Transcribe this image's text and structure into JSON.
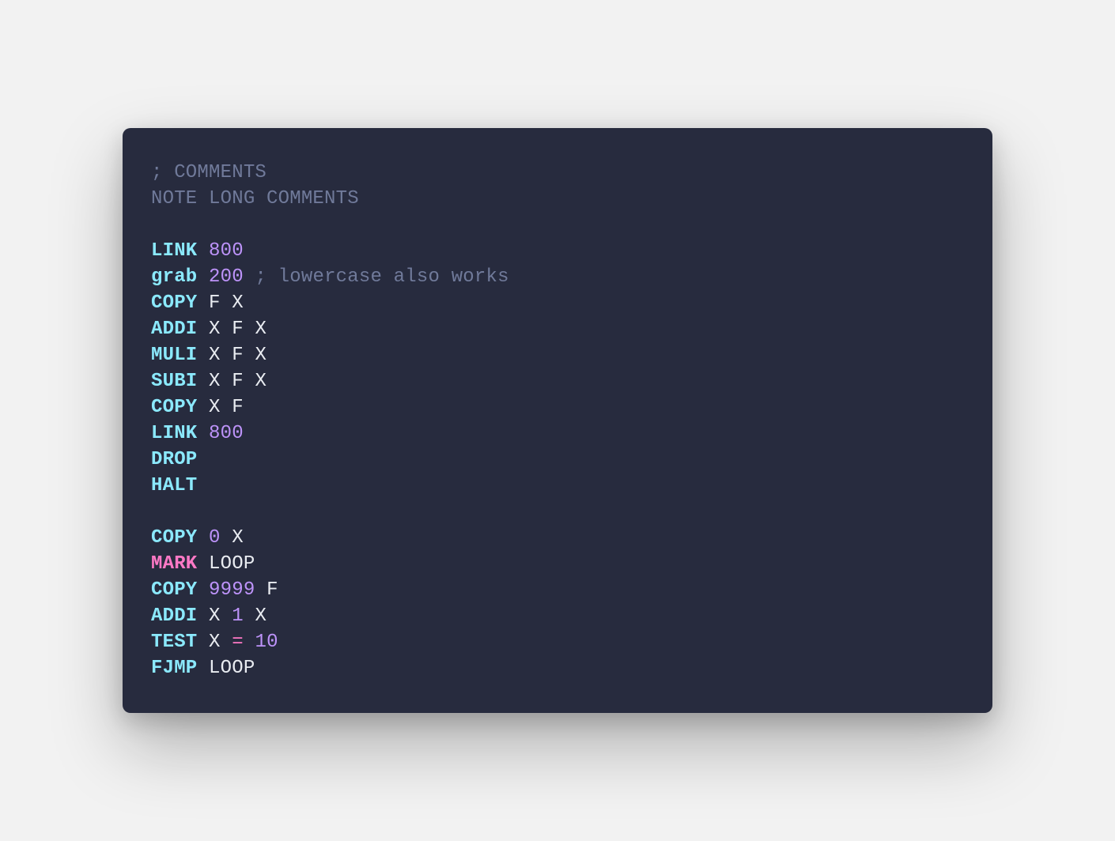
{
  "colors": {
    "page_bg": "#f2f2f2",
    "card_bg": "#272b3e",
    "comment": "#707a9a",
    "keyword": "#8be9fd",
    "mark": "#ff79c6",
    "number": "#bd93f9",
    "operator": "#ff79c6",
    "text": "#e9ecf1"
  },
  "code_lines": [
    [
      {
        "type": "comment",
        "text": "; COMMENTS"
      }
    ],
    [
      {
        "type": "comment",
        "text": "NOTE LONG COMMENTS"
      }
    ],
    [],
    [
      {
        "type": "keyword",
        "text": "LINK"
      },
      {
        "type": "space",
        "text": " "
      },
      {
        "type": "number",
        "text": "800"
      }
    ],
    [
      {
        "type": "keyword",
        "text": "grab"
      },
      {
        "type": "space",
        "text": " "
      },
      {
        "type": "number",
        "text": "200"
      },
      {
        "type": "space",
        "text": " "
      },
      {
        "type": "comment",
        "text": "; lowercase also works"
      }
    ],
    [
      {
        "type": "keyword",
        "text": "COPY"
      },
      {
        "type": "space",
        "text": " "
      },
      {
        "type": "text",
        "text": "F X"
      }
    ],
    [
      {
        "type": "keyword",
        "text": "ADDI"
      },
      {
        "type": "space",
        "text": " "
      },
      {
        "type": "text",
        "text": "X F X"
      }
    ],
    [
      {
        "type": "keyword",
        "text": "MULI"
      },
      {
        "type": "space",
        "text": " "
      },
      {
        "type": "text",
        "text": "X F X"
      }
    ],
    [
      {
        "type": "keyword",
        "text": "SUBI"
      },
      {
        "type": "space",
        "text": " "
      },
      {
        "type": "text",
        "text": "X F X"
      }
    ],
    [
      {
        "type": "keyword",
        "text": "COPY"
      },
      {
        "type": "space",
        "text": " "
      },
      {
        "type": "text",
        "text": "X F"
      }
    ],
    [
      {
        "type": "keyword",
        "text": "LINK"
      },
      {
        "type": "space",
        "text": " "
      },
      {
        "type": "number",
        "text": "800"
      }
    ],
    [
      {
        "type": "keyword",
        "text": "DROP"
      }
    ],
    [
      {
        "type": "keyword",
        "text": "HALT"
      }
    ],
    [],
    [
      {
        "type": "keyword",
        "text": "COPY"
      },
      {
        "type": "space",
        "text": " "
      },
      {
        "type": "number",
        "text": "0"
      },
      {
        "type": "space",
        "text": " "
      },
      {
        "type": "text",
        "text": "X"
      }
    ],
    [
      {
        "type": "mark",
        "text": "MARK"
      },
      {
        "type": "space",
        "text": " "
      },
      {
        "type": "text",
        "text": "LOOP"
      }
    ],
    [
      {
        "type": "keyword",
        "text": "COPY"
      },
      {
        "type": "space",
        "text": " "
      },
      {
        "type": "number",
        "text": "9999"
      },
      {
        "type": "space",
        "text": " "
      },
      {
        "type": "text",
        "text": "F"
      }
    ],
    [
      {
        "type": "keyword",
        "text": "ADDI"
      },
      {
        "type": "space",
        "text": " "
      },
      {
        "type": "text",
        "text": "X"
      },
      {
        "type": "space",
        "text": " "
      },
      {
        "type": "number",
        "text": "1"
      },
      {
        "type": "space",
        "text": " "
      },
      {
        "type": "text",
        "text": "X"
      }
    ],
    [
      {
        "type": "keyword",
        "text": "TEST"
      },
      {
        "type": "space",
        "text": " "
      },
      {
        "type": "text",
        "text": "X"
      },
      {
        "type": "space",
        "text": " "
      },
      {
        "type": "operator",
        "text": "="
      },
      {
        "type": "space",
        "text": " "
      },
      {
        "type": "number",
        "text": "10"
      }
    ],
    [
      {
        "type": "keyword",
        "text": "FJMP"
      },
      {
        "type": "space",
        "text": " "
      },
      {
        "type": "text",
        "text": "LOOP"
      }
    ]
  ]
}
